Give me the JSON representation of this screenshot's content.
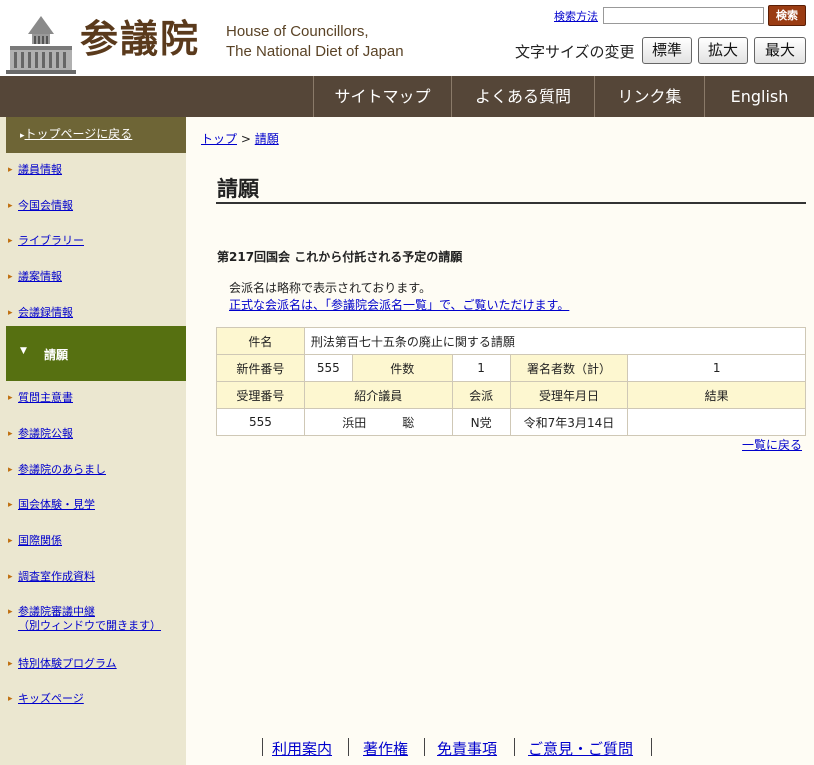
{
  "header": {
    "logo_kanji": "参議院",
    "logo_english_1": "House of Councillors,",
    "logo_english_2": "The National Diet of Japan",
    "search_help": "検索方法",
    "search_placeholder": "",
    "search_button": "検索",
    "font_size_label": "文字サイズの変更",
    "font_sizes": [
      "標準",
      "拡大",
      "最大"
    ]
  },
  "nav": [
    "サイトマップ",
    "よくある質問",
    "リンク集",
    "English"
  ],
  "sidebar": {
    "top": "トップページに戻る",
    "items": [
      "議員情報",
      "今国会情報",
      "ライブラリー",
      "議案情報",
      "会議録情報"
    ],
    "active": "請願",
    "items2": [
      "質問主意書",
      "参議院公報",
      "参議院のあらまし",
      "国会体験・見学",
      "国際関係",
      "調査室作成資料",
      "参議院審議中継",
      "特別体験プログラム",
      "キッズページ"
    ],
    "streaming_note": "（別ウィンドウで開きます）"
  },
  "breadcrumb": {
    "home": "トップ",
    "sep": ">",
    "current": "請願"
  },
  "page_title": "請願",
  "section_heading": "第217回国会 これから付託される予定の請願",
  "note": {
    "text": "会派名は略称で表示されております。",
    "link": "正式な会派名は、「参議院会派名一覧」で、ご覧いただけます。"
  },
  "table": {
    "subject_label": "件名",
    "subject_value": "刑法第百七十五条の廃止に関する請願",
    "new_no_label": "新件番号",
    "new_no_value": "555",
    "count_label": "件数",
    "count_value": "1",
    "signers_label": "署名者数（計）",
    "signers_value": "1",
    "headers": [
      "受理番号",
      "紹介議員",
      "会派",
      "受理年月日",
      "結果"
    ],
    "row": [
      "555",
      "浜田　　　聡",
      "N党",
      "令和7年3月14日",
      ""
    ]
  },
  "back_link": "一覧に戻る",
  "footer": [
    "利用案内",
    "著作権",
    "免責事項",
    "ご意見・ご質問"
  ]
}
